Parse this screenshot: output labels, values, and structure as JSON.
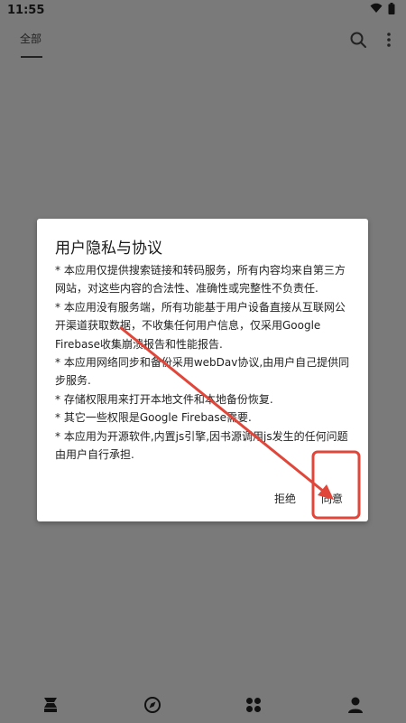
{
  "status_bar": {
    "time": "11:55",
    "icons": [
      "wifi-icon",
      "battery-icon"
    ]
  },
  "app_bar": {
    "tab_label": "全部",
    "actions": [
      "search-icon",
      "more-vert-icon"
    ]
  },
  "dialog": {
    "title": "用户隐私与协议",
    "body": [
      "* 本应用仅提供搜索链接和转码服务，所有内容均来自第三方网站，对这些内容的合法性、准确性或完整性不负责任.",
      "* 本应用没有服务端，所有功能基于用户设备直接从互联网公开渠道获取数据，不收集任何用户信息，仅采用Google Firebase收集崩溃报告和性能报告.",
      "* 本应用网络同步和备份采用webDav协议,由用户自己提供同步服务.",
      "* 存储权限用来打开本地文件和本地备份恢复.",
      "* 其它一些权限是Google Firebase需要.",
      "* 本应用为开源软件,内置js引擎,因书源调用js发生的任何问题由用户自行承担."
    ],
    "reject_label": "拒绝",
    "agree_label": "同意"
  },
  "annotation": {
    "color": "#e0463a"
  },
  "bottom_nav": {
    "items": [
      "bookshelf-icon",
      "explore-icon",
      "rss-icon",
      "profile-icon"
    ]
  }
}
